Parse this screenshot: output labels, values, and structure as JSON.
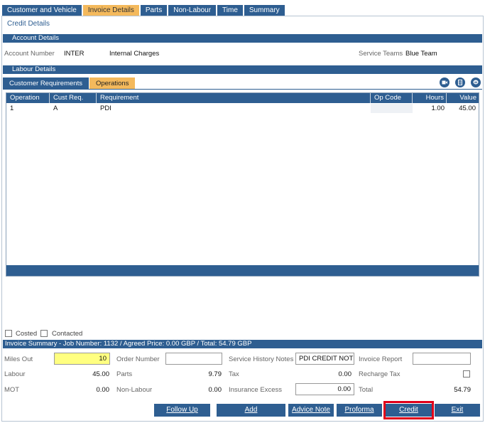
{
  "tabs": [
    "Customer and Vehicle",
    "Invoice Details",
    "Parts",
    "Non-Labour",
    "Time",
    "Summary"
  ],
  "active_tab": "Invoice Details",
  "page_title": "Credit Details",
  "account_section": {
    "title": "Account Details",
    "account_number_label": "Account Number",
    "account_number": "INTER",
    "account_name": "Internal Charges",
    "service_teams_label": "Service Teams",
    "service_team": "Blue Team"
  },
  "labour_section": {
    "title": "Labour Details",
    "subtabs": [
      "Customer Requirements",
      "Operations"
    ],
    "active_subtab": "Operations",
    "icons": [
      "video-icon",
      "document-icon",
      "note-icon"
    ],
    "columns": [
      "Operation",
      "Cust Req.",
      "Requirement",
      "Op Code",
      "Hours",
      "Value"
    ],
    "rows": [
      {
        "operation": "1",
        "cust_req": "A",
        "requirement": "PDI",
        "op_code": "",
        "hours": "1.00",
        "value": "45.00"
      }
    ]
  },
  "checkboxes": {
    "costed": "Costed",
    "contacted": "Contacted"
  },
  "invoice_summary": {
    "title": "Invoice Summary - Job Number: 1132 / Agreed Price: 0.00 GBP / Total: 54.79 GBP",
    "miles_out_label": "Miles Out",
    "miles_out": "10",
    "order_number_label": "Order Number",
    "order_number": "",
    "service_history_notes_label": "Service History Notes",
    "service_history_notes": "PDI CREDIT NOTE",
    "invoice_report_label": "Invoice Report",
    "invoice_report": "",
    "labour_label": "Labour",
    "labour": "45.00",
    "parts_label": "Parts",
    "parts": "9.79",
    "tax_label": "Tax",
    "tax": "0.00",
    "recharge_tax_label": "Recharge Tax",
    "mot_label": "MOT",
    "mot": "0.00",
    "non_labour_label": "Non-Labour",
    "non_labour": "0.00",
    "insurance_excess_label": "Insurance Excess",
    "insurance_excess": "0.00",
    "total_label": "Total",
    "total": "54.79"
  },
  "buttons": {
    "follow_up": "Follow Up",
    "add": "Add",
    "advice_note": "Advice Note",
    "proforma": "Proforma",
    "credit": "Credit",
    "exit": "Exit"
  },
  "colors": {
    "primary": "#2e5e91",
    "active_tab": "#f4b95c",
    "highlight": "#e0001a",
    "miles_field": "#ffff80"
  }
}
